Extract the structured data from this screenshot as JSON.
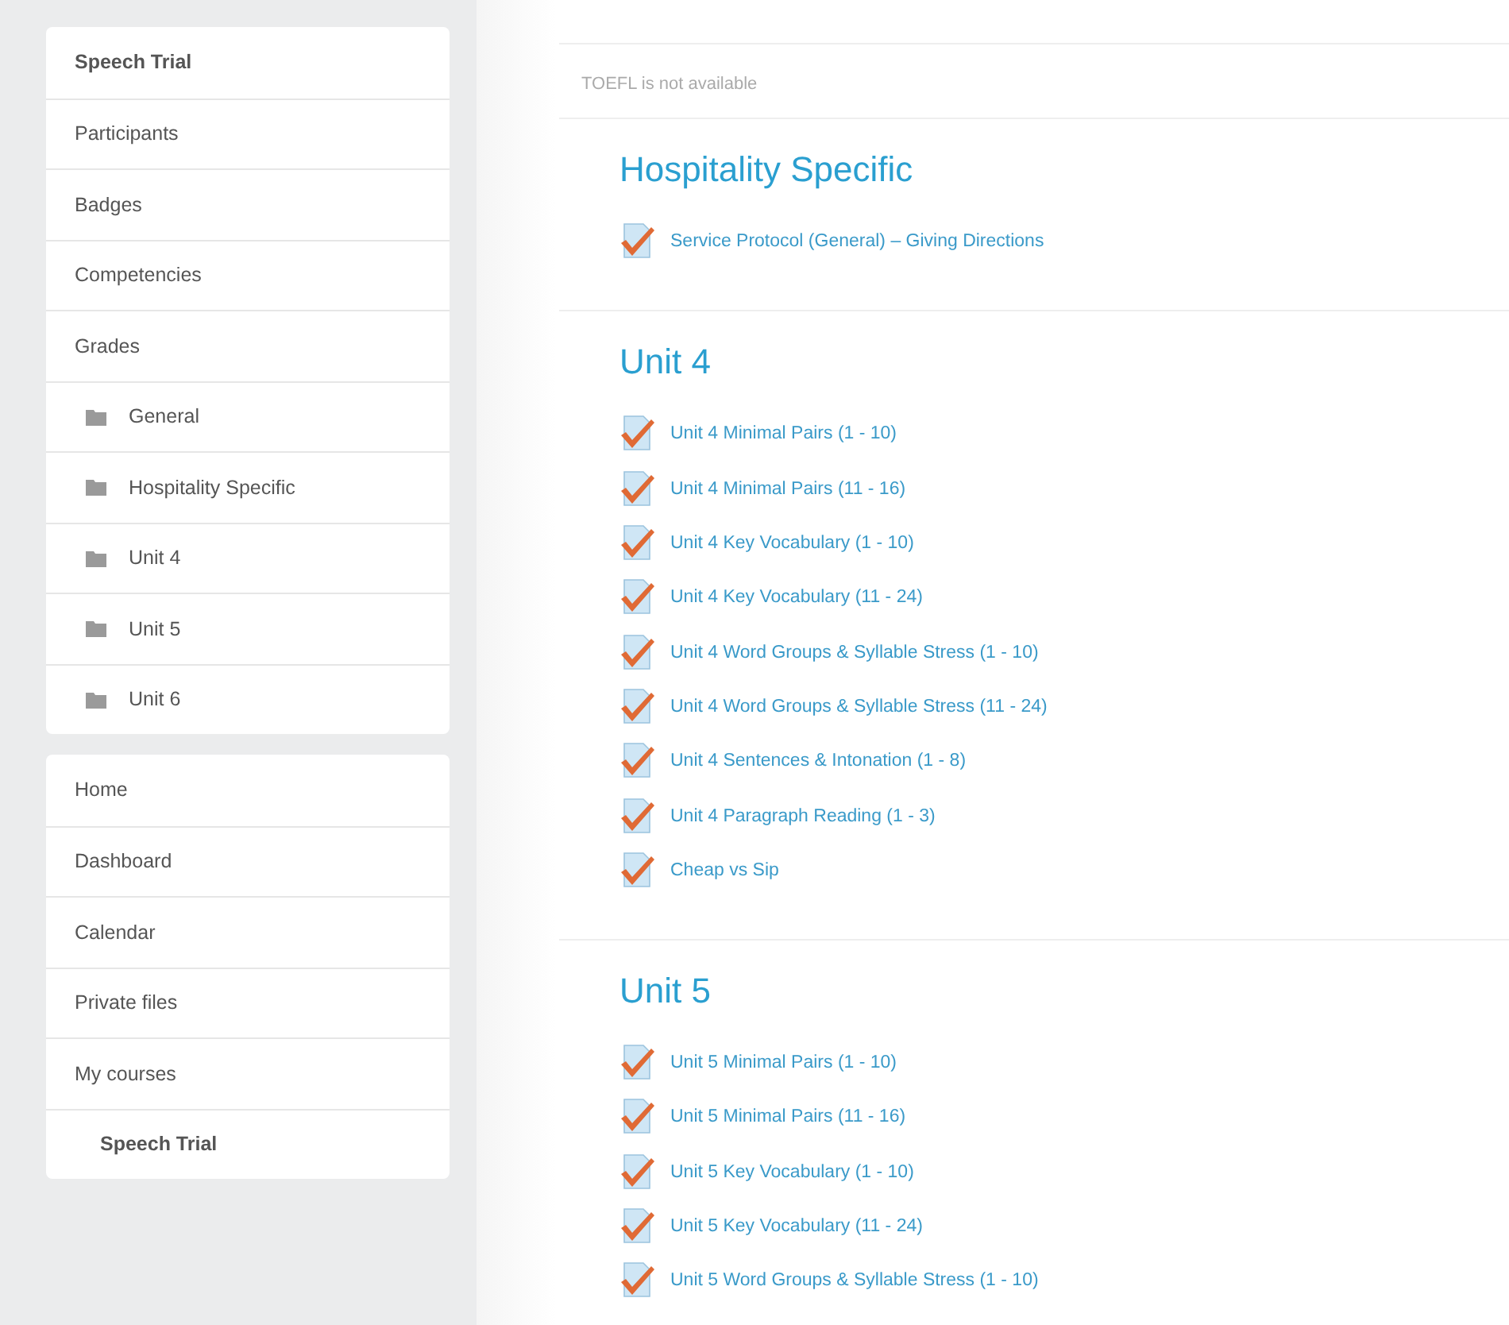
{
  "sidebar": {
    "blocks": [
      {
        "items": [
          {
            "kind": "header",
            "label": "Speech Trial"
          },
          {
            "kind": "link",
            "label": "Participants"
          },
          {
            "kind": "link",
            "label": "Badges"
          },
          {
            "kind": "link",
            "label": "Competencies"
          },
          {
            "kind": "link",
            "label": "Grades"
          },
          {
            "kind": "folder",
            "label": "General"
          },
          {
            "kind": "folder",
            "label": "Hospitality Specific"
          },
          {
            "kind": "folder",
            "label": "Unit 4"
          },
          {
            "kind": "folder",
            "label": "Unit 5"
          },
          {
            "kind": "folder",
            "label": "Unit 6"
          }
        ]
      },
      {
        "items": [
          {
            "kind": "link",
            "label": "Home"
          },
          {
            "kind": "link",
            "label": "Dashboard"
          },
          {
            "kind": "link",
            "label": "Calendar"
          },
          {
            "kind": "link",
            "label": "Private files"
          },
          {
            "kind": "link",
            "label": "My courses"
          },
          {
            "kind": "course",
            "label": "Speech Trial"
          }
        ]
      }
    ]
  },
  "notice": "TOEFL is not available",
  "sections": [
    {
      "title": "Hospitality Specific",
      "activities": [
        "Service Protocol (General) – Giving Directions"
      ]
    },
    {
      "title": "Unit 4",
      "activities": [
        "Unit 4 Minimal Pairs (1 - 10)",
        "Unit 4 Minimal Pairs (11 - 16)",
        "Unit 4 Key Vocabulary (1 - 10)",
        "Unit 4 Key Vocabulary (11 - 24)",
        "Unit 4 Word Groups & Syllable Stress (1 - 10)",
        "Unit 4 Word Groups & Syllable Stress (11 - 24)",
        "Unit 4 Sentences & Intonation (1 - 8)",
        "Unit 4 Paragraph Reading (1 - 3)",
        "Cheap vs Sip"
      ]
    },
    {
      "title": "Unit 5",
      "activities": [
        "Unit 5 Minimal Pairs (1 - 10)",
        "Unit 5 Minimal Pairs (11 - 16)",
        "Unit 5 Key Vocabulary (1 - 10)",
        "Unit 5 Key Vocabulary (11 - 24)",
        "Unit 5 Word Groups & Syllable Stress (1 - 10)"
      ]
    }
  ]
}
